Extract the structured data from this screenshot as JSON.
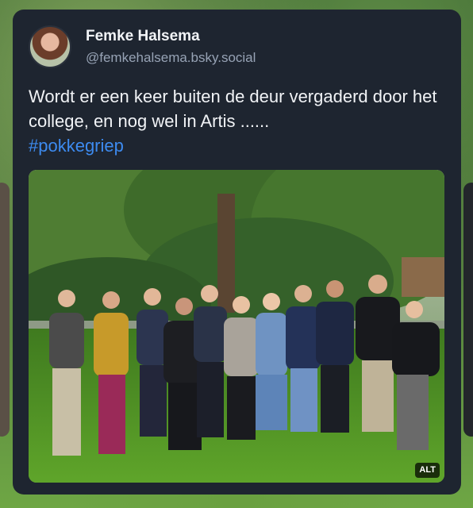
{
  "post": {
    "author": {
      "display_name": "Femke Halsema",
      "handle": "@femkehalsema.bsky.social"
    },
    "text": "Wordt er een keer buiten de deur vergaderd door het college, en nog wel in Artis ......",
    "hashtag": "#pokkegriep",
    "image": {
      "alt_badge": "ALT"
    }
  },
  "colors": {
    "card_bg": "#1e2530",
    "text": "#f1f3f6",
    "handle": "#97a3b5",
    "link": "#3d8bf0"
  }
}
